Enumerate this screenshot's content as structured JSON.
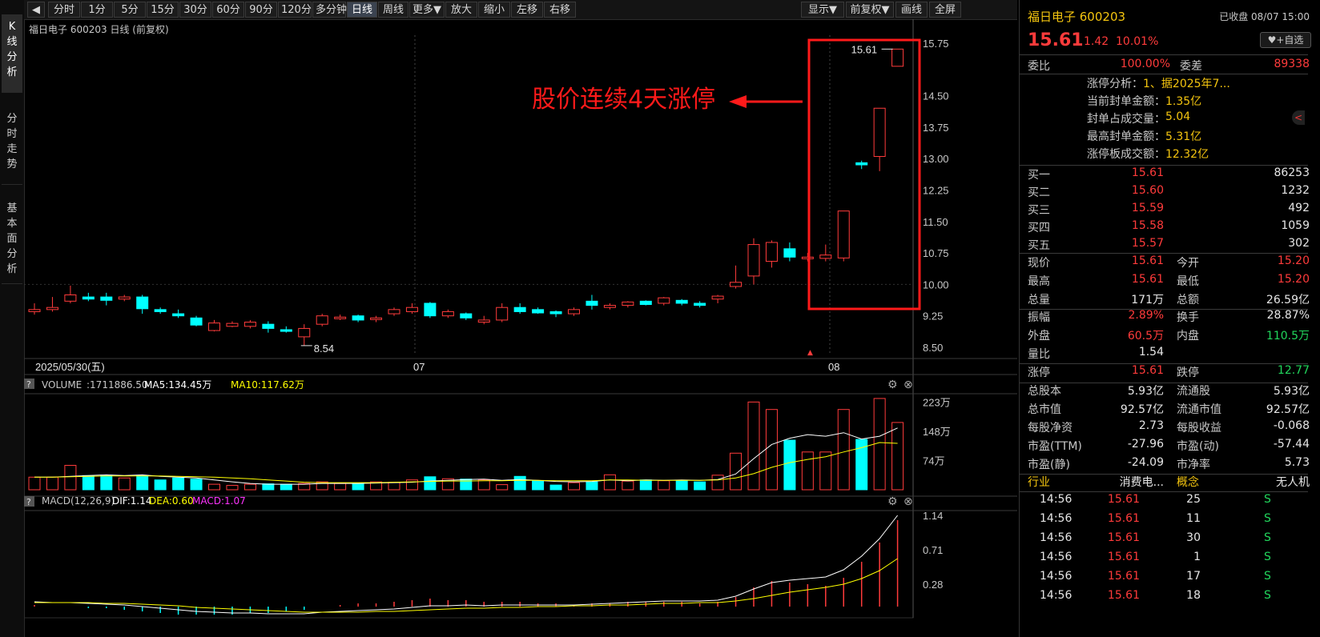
{
  "toolbar": {
    "back": "◀",
    "periods": [
      "分时",
      "1分",
      "5分",
      "15分",
      "30分",
      "60分",
      "90分",
      "120分",
      "多分钟",
      "日线",
      "周线",
      "更多▼",
      "放大",
      "缩小",
      "左移",
      "右移"
    ],
    "right": [
      "显示▼",
      "前复权▼",
      "画线",
      "全屏"
    ]
  },
  "left_tabs": [
    "K线分析",
    "分时走势",
    "基本面分析"
  ],
  "chart": {
    "title": "福日电子 600203 日线",
    "adj": "(前复权)",
    "price_labels": [
      "15.75",
      "14.50",
      "13.75",
      "13.00",
      "12.25",
      "11.50",
      "10.75",
      "10.00",
      "9.25",
      "8.50"
    ],
    "max_label": "15.61",
    "min_label": "8.54",
    "annotation": "股价连续4天涨停",
    "date_labels": [
      "2025/05/30(五)",
      "07",
      "08"
    ],
    "volume_title": "VOLUME",
    "volume_value": ":1711886.50",
    "volume_ma5": "MA5:134.45万",
    "volume_ma10": "MA10:117.62万",
    "volume_axis": [
      "223万",
      "148万",
      "74万"
    ],
    "macd_title": "MACD(12,26,9)",
    "macd_dif": "DIF:1.14",
    "macd_dea": "DEA:0.60",
    "macd_macd": "MACD:1.07",
    "macd_axis": [
      "1.14",
      "0.71",
      "0.28"
    ],
    "help": "?",
    "colors": {
      "up": "#ff3b3b",
      "down": "#00ffff",
      "ma5": "#ffffff",
      "ma10": "#ffff00",
      "macd": "#ff33ff",
      "box": "#ff1a1a"
    }
  },
  "chart_data": {
    "type": "candlestick",
    "candles": [
      [
        9.35,
        9.55,
        9.28,
        9.4
      ],
      [
        9.4,
        9.7,
        9.35,
        9.45
      ],
      [
        9.6,
        9.97,
        9.55,
        9.75
      ],
      [
        9.7,
        9.8,
        9.6,
        9.65
      ],
      [
        9.7,
        9.8,
        9.5,
        9.62
      ],
      [
        9.65,
        9.75,
        9.6,
        9.7
      ],
      [
        9.7,
        9.75,
        9.3,
        9.42
      ],
      [
        9.4,
        9.45,
        9.3,
        9.35
      ],
      [
        9.3,
        9.4,
        9.2,
        9.25
      ],
      [
        9.2,
        9.25,
        9.0,
        9.03
      ],
      [
        8.9,
        9.15,
        8.88,
        9.08
      ],
      [
        9.0,
        9.12,
        8.98,
        9.07
      ],
      [
        9.0,
        9.15,
        8.95,
        9.1
      ],
      [
        9.05,
        9.12,
        8.85,
        8.95
      ],
      [
        8.92,
        9.0,
        8.85,
        8.88
      ],
      [
        8.75,
        9.05,
        8.54,
        8.95
      ],
      [
        9.05,
        9.3,
        9.0,
        9.25
      ],
      [
        9.2,
        9.28,
        9.15,
        9.22
      ],
      [
        9.25,
        9.28,
        9.1,
        9.15
      ],
      [
        9.18,
        9.25,
        9.1,
        9.2
      ],
      [
        9.3,
        9.45,
        9.25,
        9.4
      ],
      [
        9.35,
        9.55,
        9.3,
        9.45
      ],
      [
        9.55,
        9.58,
        9.2,
        9.25
      ],
      [
        9.25,
        9.4,
        9.2,
        9.35
      ],
      [
        9.3,
        9.33,
        9.15,
        9.2
      ],
      [
        9.1,
        9.25,
        9.05,
        9.15
      ],
      [
        9.15,
        9.55,
        9.1,
        9.45
      ],
      [
        9.45,
        9.55,
        9.3,
        9.35
      ],
      [
        9.4,
        9.45,
        9.3,
        9.32
      ],
      [
        9.35,
        9.38,
        9.22,
        9.3
      ],
      [
        9.3,
        9.45,
        9.25,
        9.4
      ],
      [
        9.6,
        9.75,
        9.4,
        9.5
      ],
      [
        9.45,
        9.55,
        9.4,
        9.5
      ],
      [
        9.5,
        9.6,
        9.45,
        9.58
      ],
      [
        9.6,
        9.62,
        9.5,
        9.52
      ],
      [
        9.55,
        9.7,
        9.5,
        9.68
      ],
      [
        9.62,
        9.65,
        9.5,
        9.55
      ],
      [
        9.55,
        9.6,
        9.45,
        9.5
      ],
      [
        9.65,
        9.75,
        9.55,
        9.72
      ],
      [
        9.95,
        10.45,
        9.9,
        10.05
      ],
      [
        10.2,
        11.1,
        10.0,
        10.95
      ],
      [
        10.55,
        11.05,
        10.4,
        11.0
      ],
      [
        10.85,
        11.0,
        10.55,
        10.65
      ],
      [
        10.62,
        10.75,
        10.55,
        10.65
      ],
      [
        10.62,
        10.95,
        10.55,
        10.7
      ],
      [
        10.63,
        11.75,
        10.55,
        11.75
      ],
      [
        12.9,
        12.95,
        12.75,
        12.85
      ],
      [
        13.05,
        14.2,
        12.7,
        14.2
      ],
      [
        15.2,
        15.61,
        15.2,
        15.61
      ]
    ],
    "volume_wan": [
      32,
      32,
      62,
      36,
      37,
      30,
      36,
      25,
      30,
      27,
      14,
      11,
      14,
      15,
      14,
      16,
      20,
      16,
      15,
      20,
      19,
      25,
      33,
      28,
      27,
      25,
      13,
      34,
      23,
      12,
      18,
      20,
      38,
      22,
      25,
      23,
      24,
      20,
      37,
      93,
      223,
      204,
      126,
      96,
      96,
      204,
      128,
      232,
      171
    ],
    "vol_ma5": [
      32,
      32,
      34,
      36,
      38,
      36,
      38,
      34,
      32,
      30,
      25,
      20,
      16,
      14,
      14,
      14,
      16,
      16,
      16,
      17,
      18,
      19,
      22,
      24,
      26,
      27,
      24,
      26,
      24,
      21,
      20,
      21,
      25,
      23,
      25,
      24,
      25,
      24,
      26,
      40,
      79,
      115,
      131,
      140,
      136,
      145,
      129,
      136,
      157
    ],
    "vol_ma10": [
      32,
      32,
      33,
      34,
      35,
      35,
      35,
      35,
      34,
      33,
      32,
      30,
      28,
      25,
      22,
      19,
      18,
      18,
      18,
      18,
      19,
      20,
      21,
      22,
      22,
      23,
      23,
      24,
      24,
      23,
      23,
      23,
      25,
      25,
      24,
      24,
      24,
      24,
      25,
      30,
      41,
      57,
      69,
      77,
      84,
      96,
      107,
      120,
      118
    ],
    "macd_dif": [
      0.06,
      0.05,
      0.05,
      0.04,
      0.03,
      0.02,
      0.0,
      -0.02,
      -0.04,
      -0.06,
      -0.07,
      -0.08,
      -0.08,
      -0.09,
      -0.09,
      -0.09,
      -0.07,
      -0.06,
      -0.05,
      -0.04,
      -0.03,
      -0.01,
      0.01,
      0.01,
      0.02,
      0.01,
      0.02,
      0.02,
      0.02,
      0.02,
      0.02,
      0.03,
      0.04,
      0.05,
      0.06,
      0.07,
      0.07,
      0.07,
      0.08,
      0.13,
      0.22,
      0.3,
      0.33,
      0.35,
      0.37,
      0.46,
      0.63,
      0.85,
      1.14
    ],
    "macd_dea": [
      0.05,
      0.05,
      0.05,
      0.05,
      0.04,
      0.04,
      0.03,
      0.02,
      0.01,
      -0.01,
      -0.02,
      -0.03,
      -0.04,
      -0.05,
      -0.06,
      -0.07,
      -0.07,
      -0.07,
      -0.07,
      -0.06,
      -0.06,
      -0.05,
      -0.04,
      -0.03,
      -0.02,
      -0.02,
      -0.01,
      -0.01,
      0.0,
      0.0,
      0.01,
      0.01,
      0.02,
      0.02,
      0.03,
      0.04,
      0.04,
      0.05,
      0.05,
      0.07,
      0.1,
      0.14,
      0.18,
      0.21,
      0.24,
      0.28,
      0.35,
      0.45,
      0.6
    ],
    "macd_ylim": [
      -0.1,
      1.2
    ]
  },
  "quote": {
    "name_code": "福日电子 600203",
    "status": "已收盘 08/07 15:00",
    "price": "15.61",
    "change": "1.42",
    "pct": "10.01%",
    "fav": "+自选",
    "weibi_label": "委比",
    "weibi": "100.00%",
    "weicha_label": "委差",
    "weicha": "89338",
    "limit_analysis": [
      {
        "k": "涨停分析：",
        "v": "1、据2025年7..."
      },
      {
        "k": "当前封单金额：",
        "v": "1.35亿"
      },
      {
        "k": "封单占成交量：",
        "v": "5.04"
      },
      {
        "k": "最高封单金额：",
        "v": "5.31亿"
      },
      {
        "k": "涨停板成交额：",
        "v": "12.32亿"
      }
    ],
    "bids": [
      {
        "label": "买一",
        "price": "15.61",
        "vol": "86253"
      },
      {
        "label": "买二",
        "price": "15.60",
        "vol": "1232"
      },
      {
        "label": "买三",
        "price": "15.59",
        "vol": "492"
      },
      {
        "label": "买四",
        "price": "15.58",
        "vol": "1059"
      },
      {
        "label": "买五",
        "price": "15.57",
        "vol": "302"
      }
    ],
    "stats1": [
      {
        "l1": "现价",
        "v1": "15.61",
        "c1": "red",
        "l2": "今开",
        "v2": "15.20",
        "c2": "red"
      },
      {
        "l1": "最高",
        "v1": "15.61",
        "c1": "red",
        "l2": "最低",
        "v2": "15.20",
        "c2": "red"
      },
      {
        "l1": "总量",
        "v1": "171万",
        "c1": "wht",
        "l2": "总额",
        "v2": "26.59亿",
        "c2": "wht"
      }
    ],
    "stats2": [
      {
        "l1": "振幅",
        "v1": "2.89%",
        "c1": "red",
        "l2": "换手",
        "v2": "28.87%",
        "c2": "wht"
      },
      {
        "l1": "外盘",
        "v1": "60.5万",
        "c1": "red",
        "l2": "内盘",
        "v2": "110.5万",
        "c2": "grn"
      },
      {
        "l1": "量比",
        "v1": "1.54",
        "c1": "wht",
        "l2": "",
        "v2": "",
        "c2": "wht"
      }
    ],
    "stats3": [
      {
        "l1": "涨停",
        "v1": "15.61",
        "c1": "red",
        "l2": "跌停",
        "v2": "12.77",
        "c2": "grn"
      }
    ],
    "stats4": [
      {
        "l1": "总股本",
        "v1": "5.93亿",
        "c1": "wht",
        "l2": "流通股",
        "v2": "5.93亿",
        "c2": "wht"
      },
      {
        "l1": "总市值",
        "v1": "92.57亿",
        "c1": "wht",
        "l2": "流通市值",
        "v2": "92.57亿",
        "c2": "wht"
      },
      {
        "l1": "每股净资",
        "v1": "2.73",
        "c1": "wht",
        "l2": "每股收益",
        "v2": "-0.068",
        "c2": "wht"
      },
      {
        "l1": "市盈(TTM)",
        "v1": "-27.96",
        "c1": "wht",
        "l2": "市盈(动)",
        "v2": "-57.44",
        "c2": "wht"
      },
      {
        "l1": "市盈(静)",
        "v1": "-24.09",
        "c1": "wht",
        "l2": "市净率",
        "v2": "5.73",
        "c2": "wht"
      }
    ],
    "industry_label": "行业",
    "industry": "消费电...",
    "concept_label": "概念",
    "concept": "无人机",
    "ticks": [
      {
        "t": "14:56",
        "p": "15.61",
        "v": "25",
        "s": "S"
      },
      {
        "t": "14:56",
        "p": "15.61",
        "v": "11",
        "s": "S"
      },
      {
        "t": "14:56",
        "p": "15.61",
        "v": "30",
        "s": "S"
      },
      {
        "t": "14:56",
        "p": "15.61",
        "v": "1",
        "s": "S"
      },
      {
        "t": "14:56",
        "p": "15.61",
        "v": "17",
        "s": "S"
      },
      {
        "t": "14:56",
        "p": "15.61",
        "v": "18",
        "s": "S"
      }
    ]
  }
}
